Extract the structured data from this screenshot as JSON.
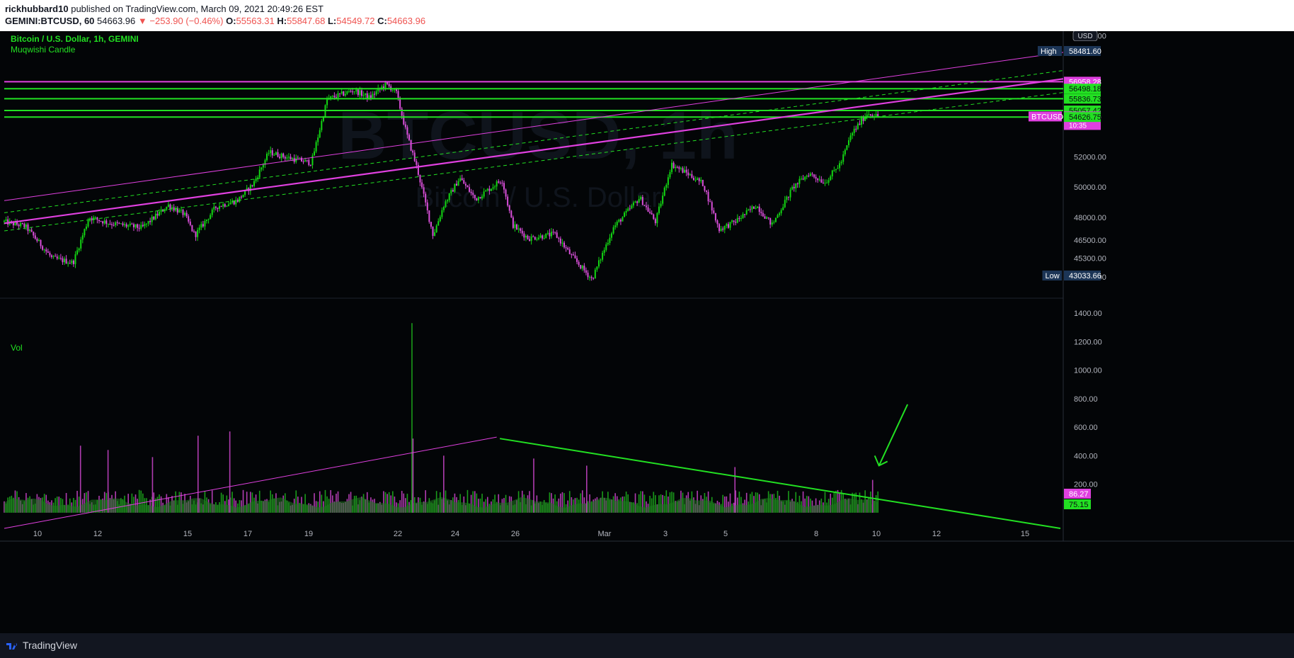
{
  "header": {
    "author": "rickhubbard10",
    "published": "published on TradingView.com, March 09, 2021 20:49:26 EST",
    "symbol": "GEMINI:BTCUSD, 60",
    "last": "54663.96",
    "change": "▼ −253.90 (−0.46%)",
    "o_label": "O:",
    "o": "55563.31",
    "h_label": "H:",
    "h": "55847.68",
    "l_label": "L:",
    "l": "54549.72",
    "c_label": "C:",
    "c": "54663.96"
  },
  "legend": {
    "title": "Bitcoin / U.S. Dollar, 1h, GEMINI",
    "indicator": "Muqwishi Candle",
    "volume": "Vol"
  },
  "watermark": {
    "line1": "BTCUSD, 1h",
    "line2": "Bitcoin / U.S. Dollar"
  },
  "footer": {
    "brand": "TradingView"
  },
  "colors": {
    "up": "#13d613",
    "down": "#d94fd9",
    "magenta": "#e040e0",
    "green": "#22e022",
    "price_tag": "#e040e0"
  },
  "chart_data": [
    {
      "type": "candlestick",
      "title": "Bitcoin / U.S. Dollar, 1h, GEMINI",
      "currency": "USD",
      "x_tick_labels": [
        "10",
        "12",
        "15",
        "17",
        "19",
        "22",
        "24",
        "26",
        "Mar",
        "3",
        "5",
        "8",
        "10",
        "12",
        "15"
      ],
      "y_tick_labels": [
        "60000.00",
        "52000.00",
        "50000.00",
        "48000.00",
        "46500.00",
        "45300.00",
        "44050.00"
      ],
      "ylim": [
        42700,
        60300
      ],
      "price_anchors": [
        {
          "x": 0,
          "y": 47700
        },
        {
          "x": 0.02,
          "y": 47400
        },
        {
          "x": 0.045,
          "y": 45300
        },
        {
          "x": 0.065,
          "y": 45000
        },
        {
          "x": 0.08,
          "y": 48000
        },
        {
          "x": 0.1,
          "y": 47600
        },
        {
          "x": 0.13,
          "y": 47300
        },
        {
          "x": 0.155,
          "y": 48800
        },
        {
          "x": 0.17,
          "y": 48200
        },
        {
          "x": 0.18,
          "y": 46800
        },
        {
          "x": 0.2,
          "y": 48700
        },
        {
          "x": 0.22,
          "y": 49100
        },
        {
          "x": 0.235,
          "y": 50200
        },
        {
          "x": 0.25,
          "y": 52300
        },
        {
          "x": 0.27,
          "y": 51900
        },
        {
          "x": 0.29,
          "y": 51600
        },
        {
          "x": 0.305,
          "y": 55800
        },
        {
          "x": 0.33,
          "y": 56400
        },
        {
          "x": 0.345,
          "y": 55900
        },
        {
          "x": 0.36,
          "y": 56800
        },
        {
          "x": 0.37,
          "y": 56300
        },
        {
          "x": 0.38,
          "y": 53500
        },
        {
          "x": 0.39,
          "y": 51200
        },
        {
          "x": 0.405,
          "y": 46800
        },
        {
          "x": 0.415,
          "y": 48800
        },
        {
          "x": 0.43,
          "y": 50600
        },
        {
          "x": 0.445,
          "y": 49200
        },
        {
          "x": 0.47,
          "y": 50500
        },
        {
          "x": 0.48,
          "y": 47500
        },
        {
          "x": 0.495,
          "y": 46600
        },
        {
          "x": 0.52,
          "y": 46900
        },
        {
          "x": 0.535,
          "y": 45500
        },
        {
          "x": 0.555,
          "y": 43900
        },
        {
          "x": 0.575,
          "y": 47300
        },
        {
          "x": 0.6,
          "y": 49300
        },
        {
          "x": 0.615,
          "y": 47700
        },
        {
          "x": 0.63,
          "y": 51500
        },
        {
          "x": 0.645,
          "y": 50900
        },
        {
          "x": 0.66,
          "y": 50200
        },
        {
          "x": 0.675,
          "y": 47200
        },
        {
          "x": 0.69,
          "y": 47700
        },
        {
          "x": 0.71,
          "y": 48800
        },
        {
          "x": 0.725,
          "y": 47500
        },
        {
          "x": 0.745,
          "y": 50000
        },
        {
          "x": 0.76,
          "y": 50900
        },
        {
          "x": 0.775,
          "y": 50300
        },
        {
          "x": 0.79,
          "y": 51600
        },
        {
          "x": 0.8,
          "y": 53500
        },
        {
          "x": 0.815,
          "y": 54900
        },
        {
          "x": 0.825,
          "y": 54663.96
        }
      ],
      "last_price": 54663.96,
      "high": 58481.6,
      "low": 43033.66,
      "levels": [
        {
          "value": 56958.28,
          "color": "#e040e0"
        },
        {
          "value": 56498.18,
          "color": "#22e022"
        },
        {
          "value": 55836.73,
          "color": "#22e022"
        },
        {
          "value": 55057.42,
          "color": "#22e022"
        },
        {
          "value": 54626.75,
          "color": "#22e022"
        }
      ],
      "axis_tags": [
        {
          "label": "High",
          "value": "58481.60",
          "style": "navy"
        },
        {
          "label": "",
          "value": "56958.28",
          "style": "magenta"
        },
        {
          "label": "",
          "value": "56498.18",
          "style": "green"
        },
        {
          "label": "",
          "value": "55836.73",
          "style": "green"
        },
        {
          "label": "",
          "value": "55057.42",
          "style": "green"
        },
        {
          "label": "BTCUSD",
          "value": "54663.96",
          "sub": "10:35",
          "style": "magenta"
        },
        {
          "label": "",
          "value": "54626.75",
          "style": "green"
        },
        {
          "label": "Low",
          "value": "43033.66",
          "style": "navy"
        }
      ],
      "channel": {
        "upper_start": 49100,
        "upper_end": 58900,
        "mid_start": 47600,
        "mid_end": 57150,
        "upper_dash_start": 48300,
        "upper_dash_end": 57700,
        "lower_dash_start": 47100,
        "lower_dash_end": 56250
      }
    },
    {
      "type": "volume",
      "title": "Vol",
      "y_tick_labels": [
        "1400.00",
        "1200.00",
        "1000.00",
        "800.00",
        "600.00",
        "400.00",
        "200.00"
      ],
      "ylim": [
        -150,
        1500
      ],
      "baseline_avg": 110,
      "spikes": [
        {
          "x": 0.072,
          "v": 470
        },
        {
          "x": 0.098,
          "v": 440
        },
        {
          "x": 0.14,
          "v": 390
        },
        {
          "x": 0.183,
          "v": 540
        },
        {
          "x": 0.213,
          "v": 570
        },
        {
          "x": 0.385,
          "v": 1330
        },
        {
          "x": 0.386,
          "v": 520
        },
        {
          "x": 0.415,
          "v": 400
        },
        {
          "x": 0.5,
          "v": 380
        },
        {
          "x": 0.55,
          "v": 330
        },
        {
          "x": 0.69,
          "v": 320
        },
        {
          "x": 0.82,
          "v": 230
        }
      ],
      "last_volume": 86.27,
      "volume_ma": 75.15,
      "axis_tags": [
        {
          "value": "86.27",
          "style": "magenta"
        },
        {
          "value": "75.15",
          "style": "green"
        }
      ],
      "trend_up": {
        "from_v": -110,
        "to_v": 530
      },
      "trend_down": {
        "from_v": 520,
        "to_v": -110
      }
    }
  ]
}
